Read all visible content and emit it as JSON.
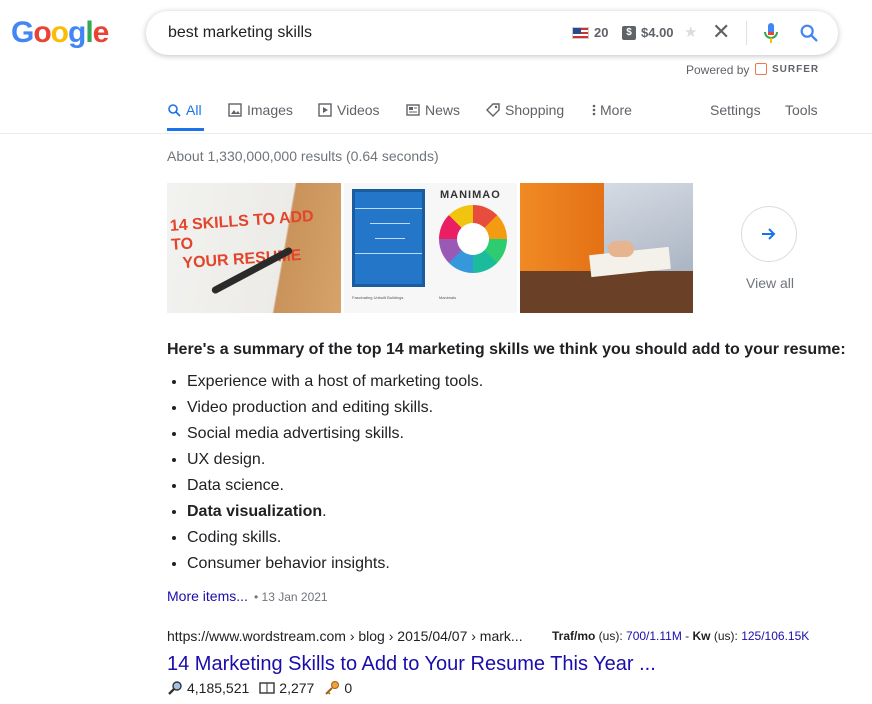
{
  "logo": {
    "text": "Google",
    "letters": [
      "G",
      "o",
      "o",
      "g",
      "l",
      "e"
    ],
    "colors": [
      "#4285f4",
      "#ea4335",
      "#fbbc05",
      "#4285f4",
      "#34a853",
      "#ea4335"
    ]
  },
  "search": {
    "query": "best marketing skills",
    "volume": "20",
    "cpc": "$4.00",
    "dollar_badge": "$",
    "star": "★",
    "clear": "✕"
  },
  "powered": {
    "label": "Powered by",
    "brand": "SURFER"
  },
  "tabs": [
    {
      "label": "All",
      "active": true,
      "icon": "search-icon"
    },
    {
      "label": "Images",
      "icon": "image-icon"
    },
    {
      "label": "Videos",
      "icon": "video-icon"
    },
    {
      "label": "News",
      "icon": "news-icon"
    },
    {
      "label": "Shopping",
      "icon": "tag-icon"
    },
    {
      "label": "More",
      "icon": "more-vert-icon"
    },
    {
      "label": "Settings"
    },
    {
      "label": "Tools"
    }
  ],
  "stats": "About 1,330,000,000 results (0.64 seconds)",
  "images": {
    "img1_text_line1": "14 SKILLS TO ADD TO",
    "img1_text_line2": "YOUR RESUME",
    "img2_title": "MANIMAO",
    "img2_caption1": "Fascinating Unbuilt Buildings",
    "img2_caption2": "Manimals",
    "view_all": "View all"
  },
  "snippet": {
    "heading": "Here's a summary of the top 14 marketing skills we think you should add to your resume:",
    "items": [
      "Experience with a host of marketing tools.",
      "Video production and editing skills.",
      "Social media advertising skills.",
      "UX design.",
      "Data science.",
      "Data visualization",
      "Coding skills.",
      "Consumer behavior insights."
    ],
    "bold_item_suffix": ".",
    "more_items": "More items...",
    "separator": "•",
    "date": "13 Jan 2021"
  },
  "result": {
    "url": "https://www.wordstream.com › blog › 2015/04/07 › mark...",
    "traf_label": "Traf/mo",
    "traf_region": " (us): ",
    "traf_value": "700/1.11M",
    "kw_sep": " - ",
    "kw_label": "Kw",
    "kw_region": " (us): ",
    "kw_value": "125/106.15K",
    "title": "14 Marketing Skills to Add to Your Resume This Year ...",
    "metric1": "4,185,521",
    "metric2": "2,277",
    "metric3": "0"
  },
  "colors": {
    "link": "#1a0dab",
    "accent": "#1a73e8",
    "muted": "#70757a"
  }
}
